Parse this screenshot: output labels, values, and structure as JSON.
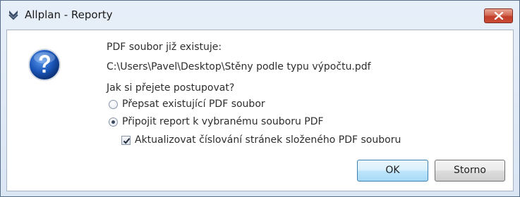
{
  "window": {
    "title": "Allplan - Reporty",
    "close_icon": "close-icon",
    "app_icon": "allplan-app-icon"
  },
  "dialog": {
    "icon": "question-icon",
    "line1": "PDF soubor již existuje:",
    "path": "C:\\Users\\Pavel\\Desktop\\Stěny podle typu výpočtu.pdf",
    "question": "Jak si přejete postupovat?",
    "options": [
      {
        "label": "Přepsat existující PDF soubor",
        "selected": false
      },
      {
        "label": "Připojit report k vybranému souboru PDF",
        "selected": true
      }
    ],
    "checkbox": {
      "label": "Aktualizovat číslování stránek složeného PDF souboru",
      "checked": true
    }
  },
  "buttons": {
    "ok": "OK",
    "cancel": "Storno"
  },
  "colors": {
    "frame": "#dbe6f4",
    "close": "#c94b34",
    "icon_blue": "#1b56b8"
  }
}
